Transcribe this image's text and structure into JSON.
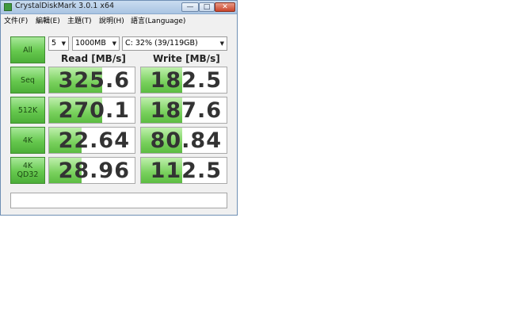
{
  "window": {
    "title": "CrystalDiskMark 3.0.1 x64",
    "min_glyph": "—",
    "max_glyph": "□",
    "close_glyph": "✕"
  },
  "menu": [
    {
      "label": "文件(F)"
    },
    {
      "label": "編輯(E)"
    },
    {
      "label": "主題(T)"
    },
    {
      "label": "說明(H)"
    },
    {
      "label": "語言(Language)"
    }
  ],
  "controls": {
    "all_label": "All",
    "count_value": "5",
    "size_value": "1000MB",
    "drive_value": "C: 32% (39/119GB)",
    "dropdown_glyph": "▼"
  },
  "headers": {
    "read": "Read [MB/s]",
    "write": "Write [MB/s]"
  },
  "rows": [
    {
      "button": [
        "Seq"
      ],
      "read": "325.6",
      "write": "182.5",
      "read_fill": 0.62,
      "write_fill": 0.48
    },
    {
      "button": [
        "512K"
      ],
      "read": "270.1",
      "write": "187.6",
      "read_fill": 0.62,
      "write_fill": 0.48
    },
    {
      "button": [
        "4K"
      ],
      "read": "22.64",
      "write": "80.84",
      "read_fill": 0.38,
      "write_fill": 0.48
    },
    {
      "button": [
        "4K",
        "QD32"
      ],
      "read": "28.96",
      "write": "112.5",
      "read_fill": 0.38,
      "write_fill": 0.48
    }
  ],
  "status_text": "",
  "colors": {
    "button_green": "#66c84e",
    "bar_green": "#78d05c",
    "value_text": "#333333"
  }
}
